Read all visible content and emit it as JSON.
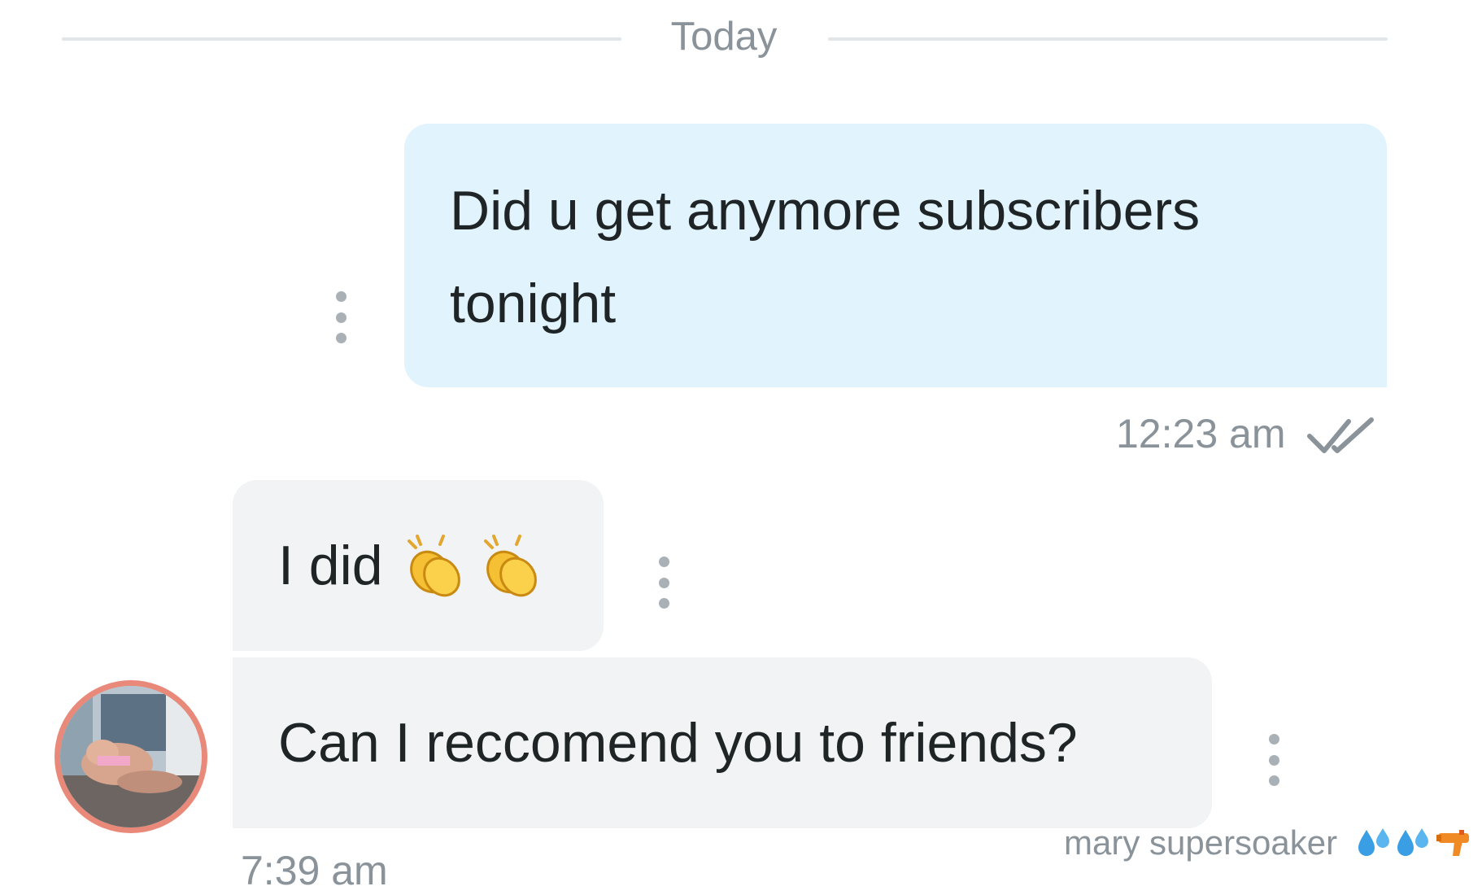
{
  "chat": {
    "date_divider": "Today",
    "messages": [
      {
        "direction": "outgoing",
        "text": "Did u get anymore subscribers tonight",
        "time": "12:23 am",
        "status": "read",
        "status_icon": "double-check-icon"
      },
      {
        "direction": "incoming",
        "text": "I did",
        "emojis": [
          "clapping-hands-icon",
          "clapping-hands-icon"
        ]
      },
      {
        "direction": "incoming",
        "text": "Can I reccomend you to friends?",
        "time": "7:39 am"
      }
    ],
    "sender": {
      "name": "mary supersoaker",
      "name_emojis": [
        "sweat-droplets-icon",
        "sweat-droplets-icon",
        "water-pistol-icon"
      ]
    },
    "more_icon": "more-vertical-icon"
  },
  "colors": {
    "outgoing_bubble": "#e1f3fc",
    "incoming_bubble": "#f1f3f4",
    "muted_text": "#8a9399",
    "avatar_ring": "#e9897a"
  }
}
